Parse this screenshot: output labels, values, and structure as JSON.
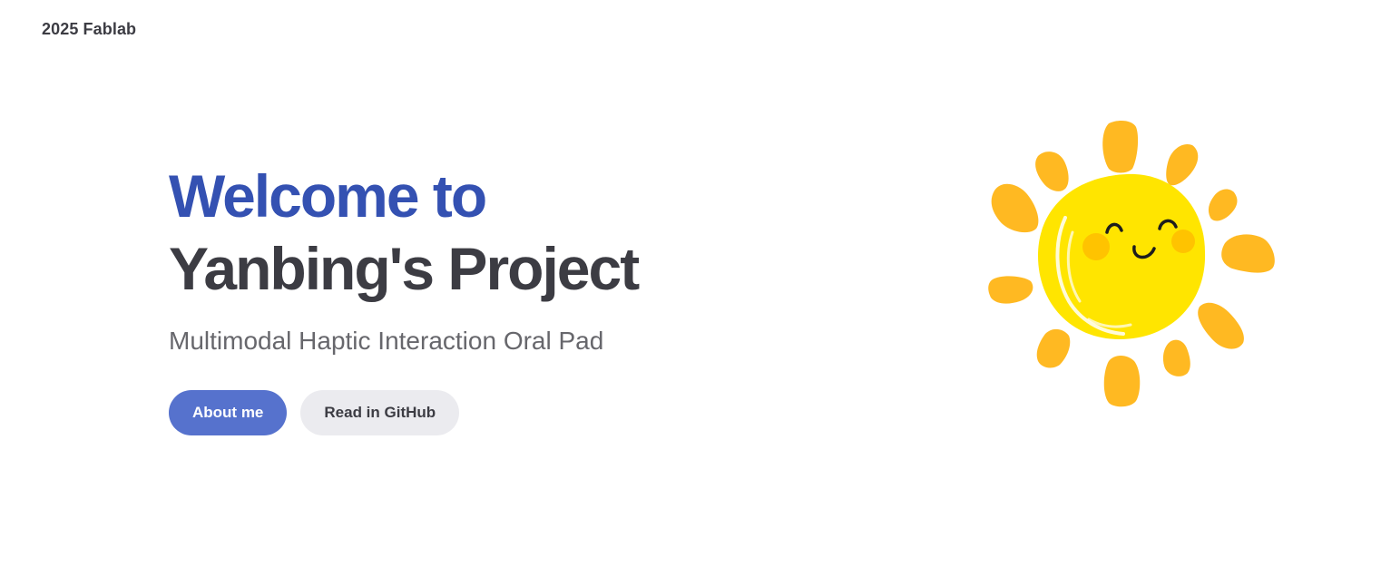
{
  "nav": {
    "site_title": "2025 Fablab"
  },
  "hero": {
    "name": "Welcome to",
    "text": "Yanbing's Project",
    "tagline": "Multimodal Haptic Interaction Oral Pad",
    "actions": [
      {
        "label": "About me",
        "theme": "brand"
      },
      {
        "label": "Read in GitHub",
        "theme": "alt"
      }
    ],
    "image": {
      "icon": "smiling-sun-icon"
    }
  },
  "colors": {
    "brand": "#3451b2",
    "button_brand": "#5672cd",
    "button_alt": "#ebebef",
    "text": "#3c3c43",
    "muted": "#67676c",
    "sun_body": "#ffe500",
    "sun_rays": "#ffb922",
    "sun_cheeks": "#ffc300"
  }
}
